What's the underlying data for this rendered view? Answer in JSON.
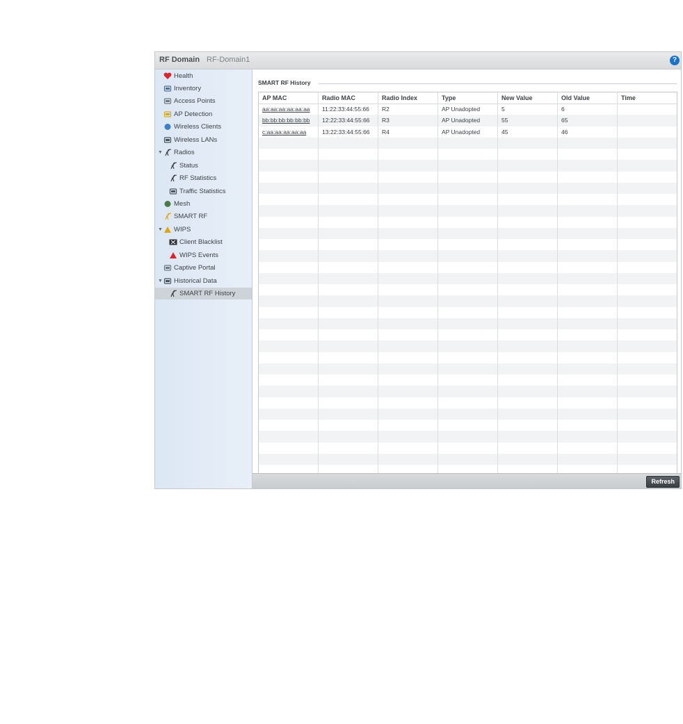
{
  "header": {
    "title": "RF Domain",
    "domain_name": "RF-Domain1",
    "help_icon": "?"
  },
  "sidebar": {
    "items": [
      {
        "label": "Health",
        "icon": "health-icon",
        "level": 0,
        "expandable": false,
        "color": "#d9262e"
      },
      {
        "label": "Inventory",
        "icon": "inventory-icon",
        "level": 0,
        "expandable": false,
        "color": "#4f6f8f"
      },
      {
        "label": "Access Points",
        "icon": "access-point-icon",
        "level": 0,
        "expandable": false,
        "color": "#6f7780"
      },
      {
        "label": "AP Detection",
        "icon": "ap-detection-icon",
        "level": 0,
        "expandable": false,
        "color": "#d9a61c"
      },
      {
        "label": "Wireless Clients",
        "icon": "wireless-client-icon",
        "level": 0,
        "expandable": false,
        "color": "#3e7fc8"
      },
      {
        "label": "Wireless LANs",
        "icon": "wlan-icon",
        "level": 0,
        "expandable": false,
        "color": "#45525e"
      },
      {
        "label": "Radios",
        "icon": "radio-icon",
        "level": 0,
        "expandable": true,
        "color": "#3a3f44"
      },
      {
        "label": "Status",
        "icon": "radio-icon",
        "level": 1,
        "expandable": false,
        "color": "#3a3f44"
      },
      {
        "label": "RF Statistics",
        "icon": "radio-icon",
        "level": 1,
        "expandable": false,
        "color": "#3a3f44"
      },
      {
        "label": "Traffic Statistics",
        "icon": "traffic-statistics-icon",
        "level": 1,
        "expandable": false,
        "color": "#45525e"
      },
      {
        "label": "Mesh",
        "icon": "mesh-icon",
        "level": 0,
        "expandable": false,
        "color": "#4d7a44"
      },
      {
        "label": "SMART RF",
        "icon": "smart-rf-icon",
        "level": 0,
        "expandable": false,
        "color": "#d9a61c"
      },
      {
        "label": "WIPS",
        "icon": "wips-icon",
        "level": 0,
        "expandable": true,
        "color": "#e0a318"
      },
      {
        "label": "Client Blacklist",
        "icon": "client-blacklist-icon",
        "level": 1,
        "expandable": false,
        "color": "#2b2f33"
      },
      {
        "label": "WIPS Events",
        "icon": "wips-events-icon",
        "level": 1,
        "expandable": false,
        "color": "#d9262e"
      },
      {
        "label": "Captive Portal",
        "icon": "captive-portal-icon",
        "level": 0,
        "expandable": false,
        "color": "#6f7780"
      },
      {
        "label": "Historical Data",
        "icon": "historical-data-icon",
        "level": 0,
        "expandable": true,
        "color": "#45525e"
      },
      {
        "label": "SMART RF History",
        "icon": "radio-icon",
        "level": 1,
        "expandable": false,
        "color": "#3a3f44",
        "selected": true
      }
    ]
  },
  "main": {
    "section_title": "SMART RF History",
    "table": {
      "columns": [
        "AP MAC",
        "Radio MAC",
        "Radio Index",
        "Type",
        "New Value",
        "Old Value",
        "Time"
      ],
      "rows": [
        [
          "aa:aa:aa:aa:aa:aa",
          "11:22:33:44:55:66",
          "R2",
          "AP Unadopted",
          "5",
          "6",
          ""
        ],
        [
          "bb:bb:bb:bb:bb:bb",
          "12:22:33:44:55:66",
          "R3",
          "AP Unadopted",
          "55",
          "65",
          ""
        ],
        [
          "c:aa:aa:aa:aa:aa",
          "13:22:33:44:55:66",
          "R4",
          "AP Unadopted",
          "45",
          "46",
          ""
        ]
      ]
    }
  },
  "footer": {
    "refresh_label": "Refresh"
  }
}
